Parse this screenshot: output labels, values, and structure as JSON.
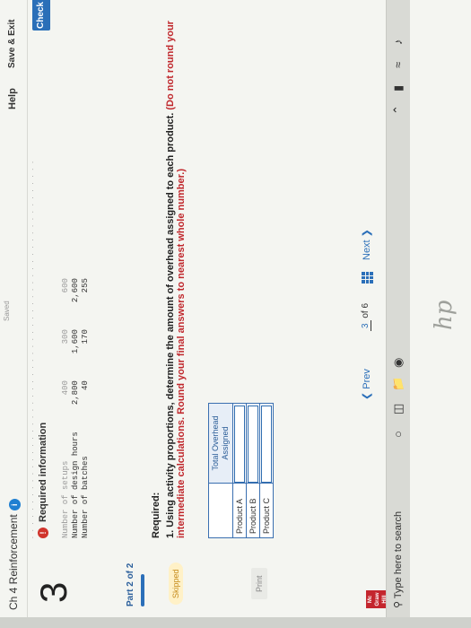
{
  "header": {
    "chapter": "Ch 4 Reinforcement",
    "info_badge": "i",
    "saved": "Saved",
    "help": "Help",
    "save_exit": "Save & Exit",
    "check": "Check"
  },
  "sidebar": {
    "question_number": "3",
    "part": "Part 2 of 2",
    "skipped": "Skipped",
    "print": "Print"
  },
  "required_info": {
    "heading": "Required information",
    "warn_icon": "!",
    "rows": [
      {
        "label": "Number of setups",
        "a": "400",
        "b": "300",
        "c": "600"
      },
      {
        "label": "Number of design hours",
        "a": "2,800",
        "b": "1,600",
        "c": "2,600"
      },
      {
        "label": "Number of batches",
        "a": "40",
        "b": "170",
        "c": "255"
      }
    ]
  },
  "task": {
    "required_label": "Required:",
    "instruction": "1. Using activity proportions, determine the amount of overhead assigned to each product.",
    "note": "(Do not round your intermediate calculations. Round your final answers to nearest whole number.)"
  },
  "answer_table": {
    "header": "Total Overhead Assigned",
    "rows": [
      {
        "label": "Product A",
        "value": ""
      },
      {
        "label": "Product B",
        "value": ""
      },
      {
        "label": "Product C",
        "value": ""
      }
    ]
  },
  "nav": {
    "prev": "Prev",
    "current": "3",
    "of_total": "of 6",
    "next": "Next"
  },
  "taskbar": {
    "search_placeholder": "Type here to search"
  },
  "logo": {
    "text": "Mc Graw Hill"
  },
  "colors": {
    "accent": "#2b6fb9",
    "warning": "#c0282d"
  }
}
